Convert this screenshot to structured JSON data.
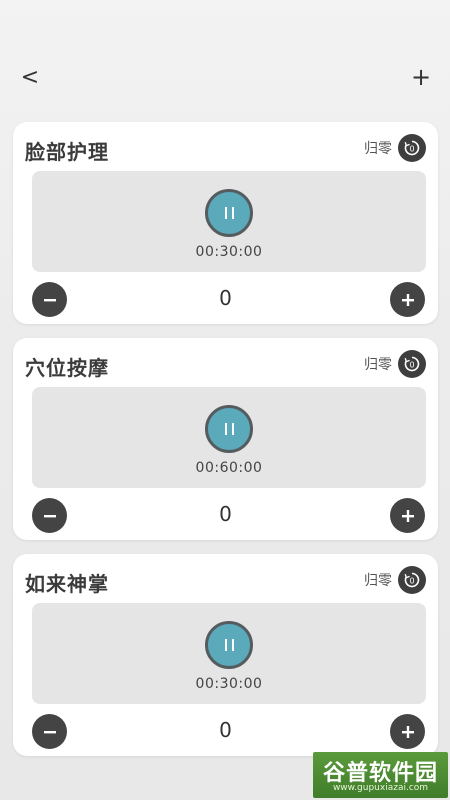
{
  "header": {
    "back_label": "<",
    "add_label": "+"
  },
  "cards": [
    {
      "title": "脸部护理",
      "reset_label": "归零",
      "time": "00:30:00",
      "count": "0"
    },
    {
      "title": "穴位按摩",
      "reset_label": "归零",
      "time": "00:60:00",
      "count": "0"
    },
    {
      "title": "如来神掌",
      "reset_label": "归零",
      "time": "00:30:00",
      "count": "0"
    }
  ],
  "watermark": {
    "title": "谷普软件园",
    "url": "www.gupuxiazai.com"
  },
  "colors": {
    "play_button": "#5aaabb",
    "dark_button": "#444444",
    "panel": "#e5e5e5"
  },
  "icons": {
    "back": "chevron-left-icon",
    "add": "plus-icon",
    "reset": "reset-timer-icon",
    "pause": "pause-icon",
    "minus": "minus-icon",
    "plus": "plus-icon"
  }
}
